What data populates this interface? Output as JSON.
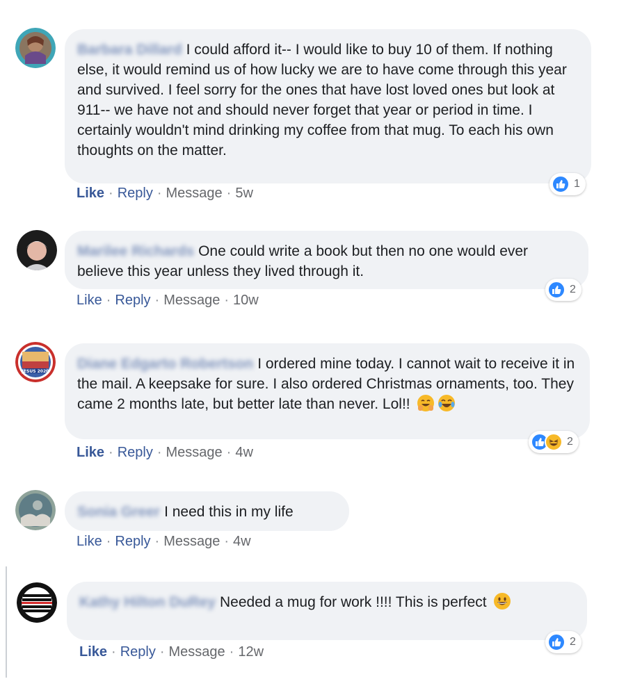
{
  "actions": {
    "like": "Like",
    "reply": "Reply",
    "message": "Message",
    "sep": "·"
  },
  "comments": [
    {
      "author_blurred": "Barbara Dillard",
      "text": "I could afford it-- I would like to buy 10 of them. If nothing else, it would remind us of how lucky we are to have come through this year and survived. I feel sorry for the ones that have lost loved ones but look at 911-- we have not and should never forget that year or period in time. I certainly wouldn't mind drinking my coffee from that mug. To each his own thoughts on the matter.",
      "time": "5w",
      "reaction_count": "1"
    },
    {
      "author_blurred": "Marilee Richards",
      "text": "One could write a book but then no one would ever believe this year unless they lived through it.",
      "time": "10w",
      "reaction_count": "2"
    },
    {
      "author_blurred": "Diane Edgarto Robertson",
      "text": "I ordered mine today. I cannot wait to receive it in the mail. A keepsake for sure. I also ordered Christmas ornaments, too. They came 2 months late, but better late than never. Lol!!",
      "time": "4w",
      "reaction_count": "2"
    },
    {
      "author_blurred": "Sonia Greer",
      "text": "I need this in my life",
      "time": "4w"
    },
    {
      "author_blurred": "Kathy Hilton DuRey",
      "text": "Needed a mug for work !!!! This is perfect",
      "time": "12w",
      "reaction_count": "2"
    }
  ],
  "avatar3_badge": "JESUS 2020",
  "colors": {
    "bubble": "#f0f2f5",
    "link": "#385898",
    "like_blue": "#2d88ff",
    "muted": "#65676b"
  }
}
